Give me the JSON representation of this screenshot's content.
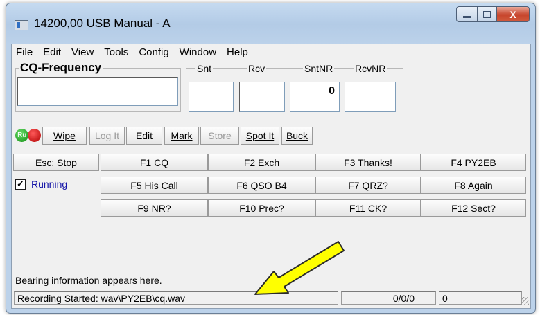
{
  "window": {
    "title": "14200,00 USB Manual - A",
    "close_glyph": "X"
  },
  "menu": [
    "File",
    "Edit",
    "View",
    "Tools",
    "Config",
    "Window",
    "Help"
  ],
  "cq_frequency": {
    "label": "CQ-Frequency",
    "value": ""
  },
  "exchange": {
    "snt_label": "Snt",
    "snt_value": "",
    "rcv_label": "Rcv",
    "rcv_value": "",
    "sntnr_label": "SntNR",
    "sntnr_value": "0",
    "rcvnr_label": "RcvNR",
    "rcvnr_value": ""
  },
  "status_leds": {
    "green_label": "Ru"
  },
  "toolbar": {
    "wipe": "Wipe",
    "log_it": "Log It",
    "edit": "Edit",
    "mark": "Mark",
    "store": "Store",
    "spot_it": "Spot It",
    "buck": "Buck"
  },
  "esc_stop": "Esc: Stop",
  "running": {
    "label": "Running",
    "checked": true,
    "check_glyph": "✓"
  },
  "function_keys": [
    [
      "F1 CQ",
      "F2 Exch",
      "F3 Thanks!",
      "F4 PY2EB"
    ],
    [
      "F5 His Call",
      "F6 QSO B4",
      "F7 QRZ?",
      "F8 Again"
    ],
    [
      "F9 NR?",
      "F10 Prec?",
      "F11 CK?",
      "F12 Sect?"
    ]
  ],
  "bearing_text": "Bearing information appears here.",
  "statusbar": {
    "message": "Recording Started: wav\\PY2EB\\cq.wav",
    "counts": "0/0/0",
    "value": "0"
  },
  "colors": {
    "arrow_fill": "#ffff00",
    "running_text": "#1515a8"
  }
}
